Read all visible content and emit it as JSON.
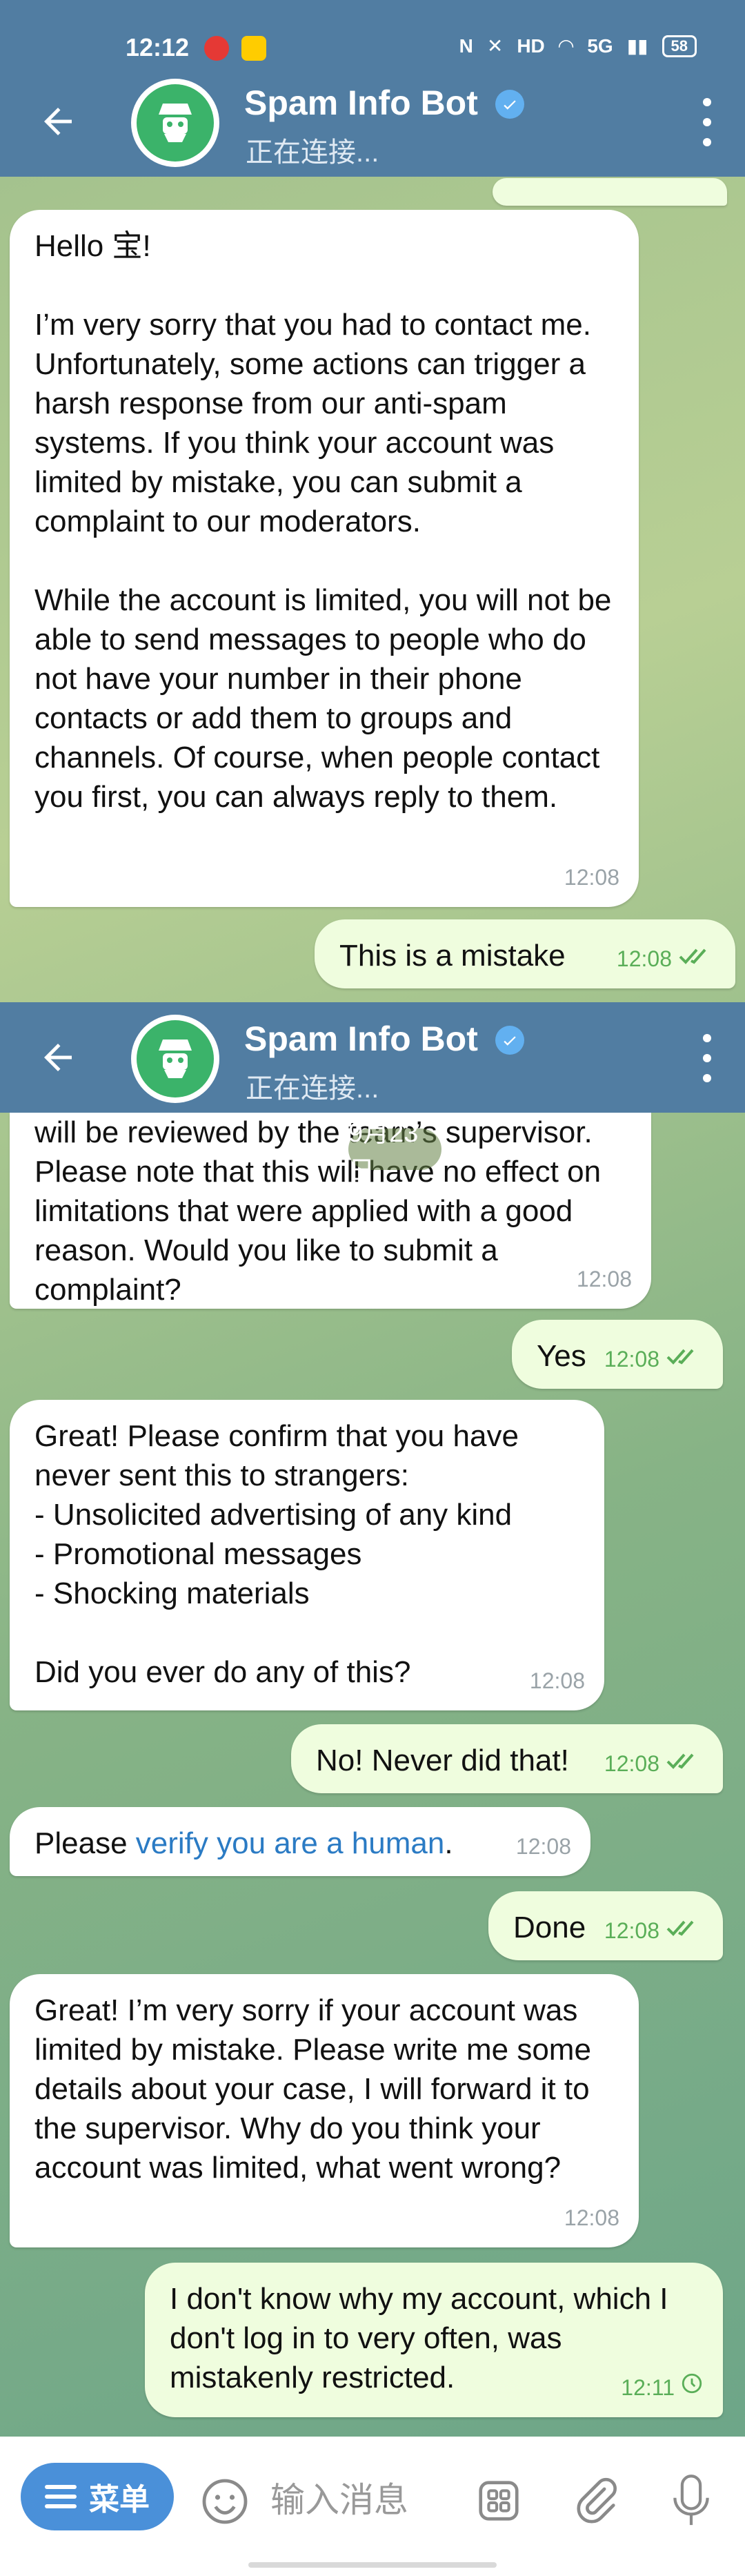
{
  "status_bar": {
    "time": "12:12",
    "network": "5G",
    "battery": "58"
  },
  "header": {
    "bot_name": "Spam Info Bot",
    "status": "正在连接..."
  },
  "date_pill": "9月23日",
  "messages_top": [
    {
      "text": "Hello 宝!\n\nI’m very sorry that you had to contact me. Unfortunately, some actions can trigger a harsh response from our anti-spam systems. If you think your account was limited by mistake, you can submit a complaint to our moderators.\n\nWhile the account is limited, you will not be able to send messages to people who do not have your number in their phone contacts or add them to groups and channels. Of course, when people contact you first, you can always reply to them.",
      "time": "12:08"
    },
    {
      "text": "This is a mistake",
      "time": "12:08"
    }
  ],
  "messages_bottom": [
    {
      "text": "will be reviewed by the team’s supervisor. Please note that this will have no effect on limitations that were applied with a good reason. Would you like to submit a complaint?",
      "time": "12:08"
    },
    {
      "text": "Yes",
      "time": "12:08"
    },
    {
      "text": "Great! Please confirm that you have never sent this to strangers:\n- Unsolicited advertising of any kind\n- Promotional messages\n- Shocking materials\n\nDid you ever do any of this?",
      "time": "12:08"
    },
    {
      "text": "No! Never did that!",
      "time": "12:08"
    },
    {
      "prefix": "Please ",
      "link": "verify you are a human",
      "suffix": ".",
      "time": "12:08"
    },
    {
      "text": "Done",
      "time": "12:08"
    },
    {
      "text": "Great! I’m very sorry if your account was limited by mistake. Please write me some details about your case, I will forward it to the supervisor. Why do you think your account was limited, what went wrong?",
      "time": "12:08"
    },
    {
      "text": "I don't know why my account, which I don't log in to very often, was mistakenly restricted.",
      "time": "12:11"
    }
  ],
  "composer": {
    "menu_label": "菜单",
    "placeholder": "输入消息"
  }
}
